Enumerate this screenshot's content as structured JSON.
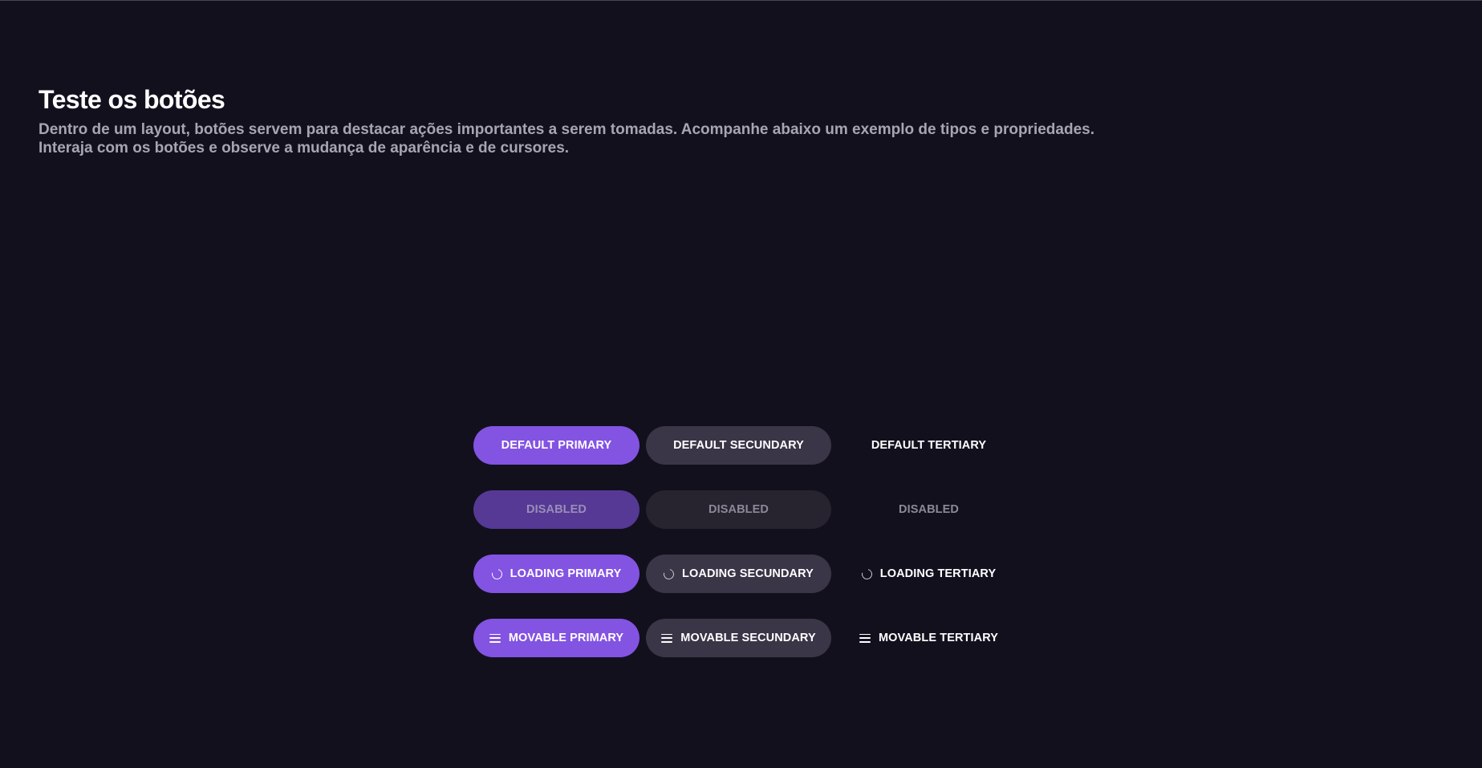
{
  "header": {
    "title": "Teste os botões",
    "description_line1": "Dentro de um layout, botões servem para destacar ações importantes a serem tomadas. Acompanhe abaixo um exemplo de tipos e propriedades.",
    "description_line2": "Interaja com os botões e observe a mudança de aparência e de cursores."
  },
  "colors": {
    "background": "#13101e",
    "primary": "#8353e2",
    "secondary": "#3a3547",
    "primary_disabled": "#553995",
    "secondary_disabled": "#27232f"
  },
  "buttons": {
    "default": {
      "primary": "DEFAULT PRIMARY",
      "secondary": "DEFAULT SECUNDARY",
      "tertiary": "DEFAULT TERTIARY"
    },
    "disabled": {
      "primary": "DISABLED",
      "secondary": "DISABLED",
      "tertiary": "DISABLED"
    },
    "loading": {
      "icon": "spinner-icon",
      "primary": "LOADING PRIMARY",
      "secondary": "LOADING SECUNDARY",
      "tertiary": "LOADING TERTIARY"
    },
    "movable": {
      "icon": "drag-handle-icon",
      "primary": "MOVABLE PRIMARY",
      "secondary": "MOVABLE SECUNDARY",
      "tertiary": "MOVABLE TERTIARY"
    }
  }
}
